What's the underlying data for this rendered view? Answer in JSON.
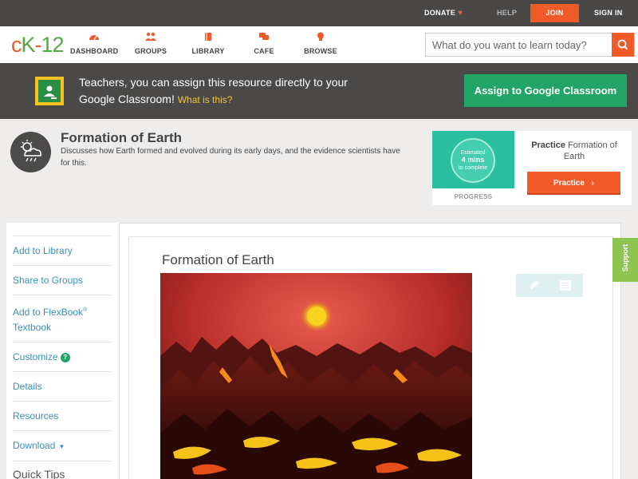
{
  "topbar": {
    "donate": "DONATE",
    "help": "HELP",
    "join": "JOIN",
    "sign_in": "SIGN IN"
  },
  "nav": {
    "logo_c": "c",
    "logo_k": "K",
    "logo_num": "12",
    "items": [
      {
        "label": "DASHBOARD",
        "icon": "speedometer-icon"
      },
      {
        "label": "GROUPS",
        "icon": "people-icon"
      },
      {
        "label": "LIBRARY",
        "icon": "book-icon"
      },
      {
        "label": "CAFE",
        "icon": "chat-icon"
      },
      {
        "label": "BROWSE",
        "icon": "lightbulb-icon"
      }
    ],
    "search_placeholder": "What do you want to learn today?"
  },
  "banner": {
    "text": "Teachers, you can assign this resource directly to your Google Classroom!",
    "link": "What is this?",
    "button": "Assign to Google Classroom"
  },
  "concept": {
    "title": "Formation of Earth",
    "description": "Discusses how Earth formed and evolved during its early days, and the evidence scientists have for this."
  },
  "practice": {
    "estimated": "Estimated",
    "mins": "4 mins",
    "to_complete": "to complete",
    "progress_label": "PROGRESS",
    "title_bold": "Practice",
    "title_rest": "Formation of Earth",
    "button": "Practice"
  },
  "sidebar": {
    "items": [
      "Add to Library",
      "Share to Groups",
      "Add to FlexBook",
      "Textbook",
      "Customize",
      "Details",
      "Resources",
      "Download"
    ],
    "flexbook_reg": "®",
    "quick_tips": "Quick Tips"
  },
  "main": {
    "title": "Formation of Earth"
  },
  "support": "Support",
  "colors": {
    "accent_orange": "#f05a28",
    "brand_green": "#53a546",
    "classroom_green": "#21a466",
    "link_blue": "#3a8fb7"
  }
}
